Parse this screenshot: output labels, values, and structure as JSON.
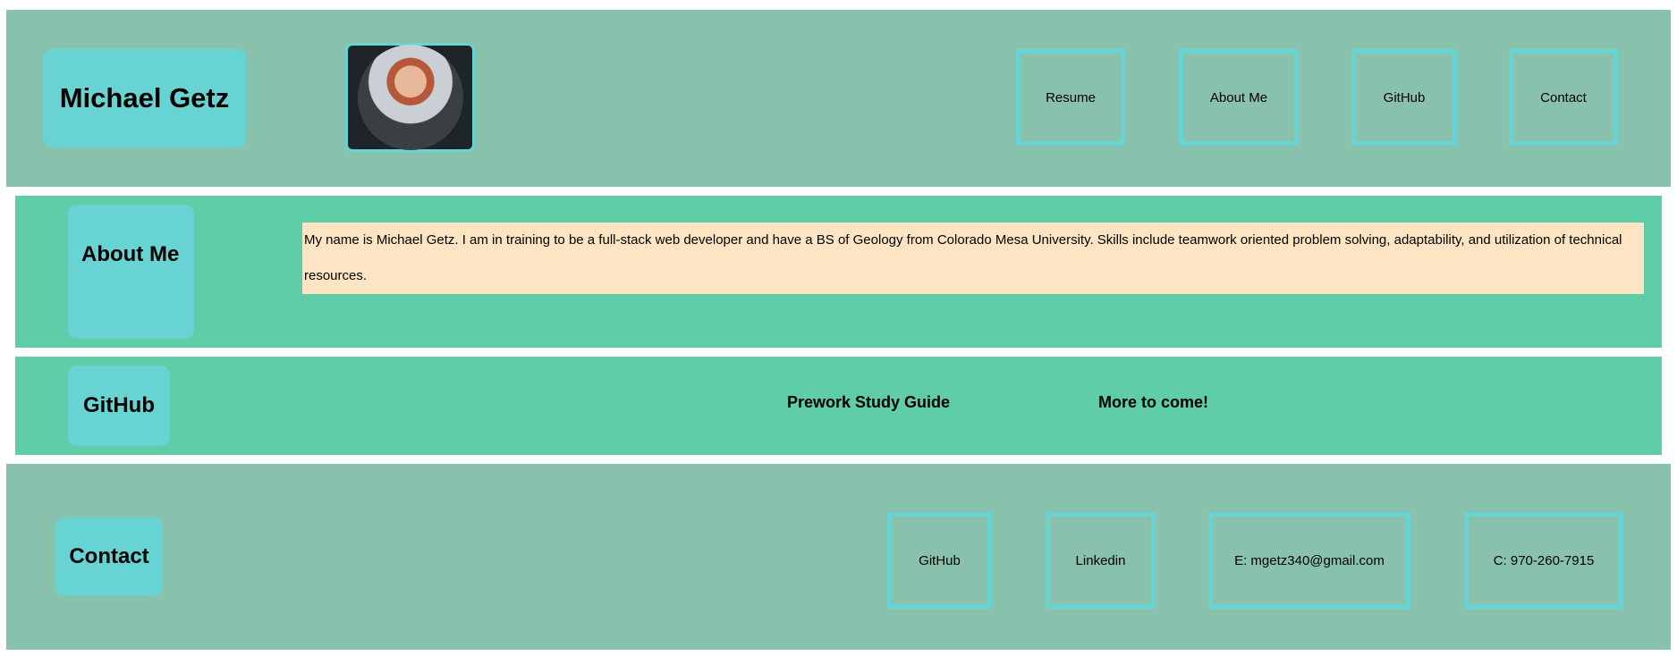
{
  "colors": {
    "header_bg": "#88c2ad",
    "section_bg": "#5ecda8",
    "accent": "#67d4d3",
    "about_text_bg": "#fde4c2"
  },
  "header": {
    "name": "Michael Getz",
    "avatar_icon": "profile-photo",
    "nav": [
      "Resume",
      "About Me",
      "GitHub",
      "Contact"
    ]
  },
  "about": {
    "title": "About Me",
    "text": "My name is Michael Getz. I am in training to be a full-stack web developer and have a BS of Geology from Colorado Mesa University. Skills include teamwork oriented problem solving, adaptability, and utilization of technical resources."
  },
  "github": {
    "title": "GitHub",
    "repos": [
      "Prework Study Guide",
      "More to come!"
    ]
  },
  "contact": {
    "title": "Contact",
    "links": [
      "GitHub",
      "Linkedin",
      "E: mgetz340@gmail.com",
      "C: 970-260-7915"
    ]
  }
}
